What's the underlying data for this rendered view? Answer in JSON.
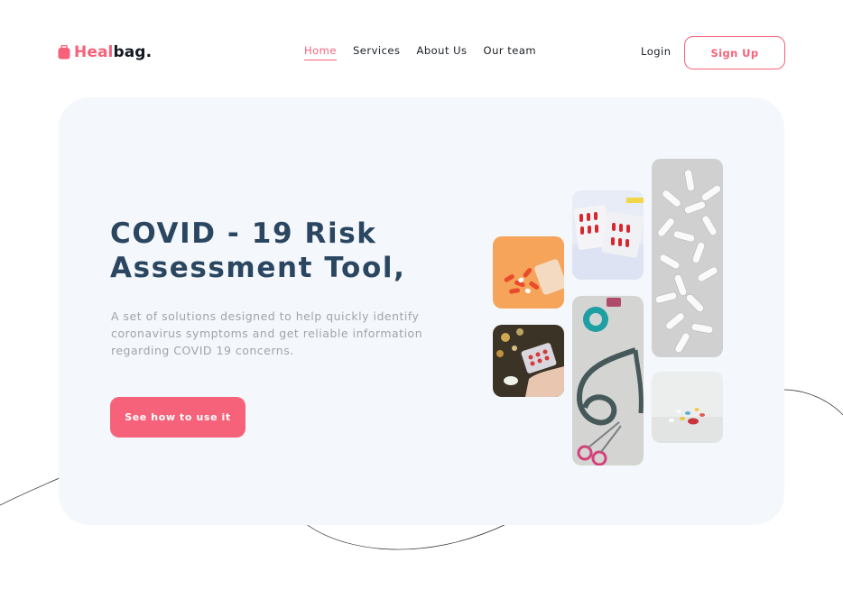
{
  "brand": {
    "name_accent": "Heal",
    "name_rest": "bag.",
    "color": "#f5627a"
  },
  "nav": {
    "items": [
      {
        "label": "Home",
        "active": true
      },
      {
        "label": "Services",
        "active": false
      },
      {
        "label": "About Us",
        "active": false
      },
      {
        "label": "Our team",
        "active": false
      }
    ]
  },
  "auth": {
    "login_label": "Login",
    "signup_label": "Sign Up"
  },
  "hero": {
    "title": "COVID - 19 Risk Assessment Tool,",
    "description": "A set of solutions designed to help quickly identify coronavirus symptoms and get reliable information regarding COVID 19 concerns.",
    "cta_label": "See how to use it"
  },
  "gallery": [
    {
      "icon": "pills-spill-photo"
    },
    {
      "icon": "pill-blister-hand-photo"
    },
    {
      "icon": "capsule-blister-packs-photo"
    },
    {
      "icon": "stethoscope-scissors-photo"
    },
    {
      "icon": "white-pills-pile-photo"
    },
    {
      "icon": "scattered-pills-photo"
    }
  ],
  "colors": {
    "accent": "#f5627a",
    "title": "#2a4660",
    "hero_bg": "#f4f7fb",
    "body_text": "#a0a5ab"
  }
}
